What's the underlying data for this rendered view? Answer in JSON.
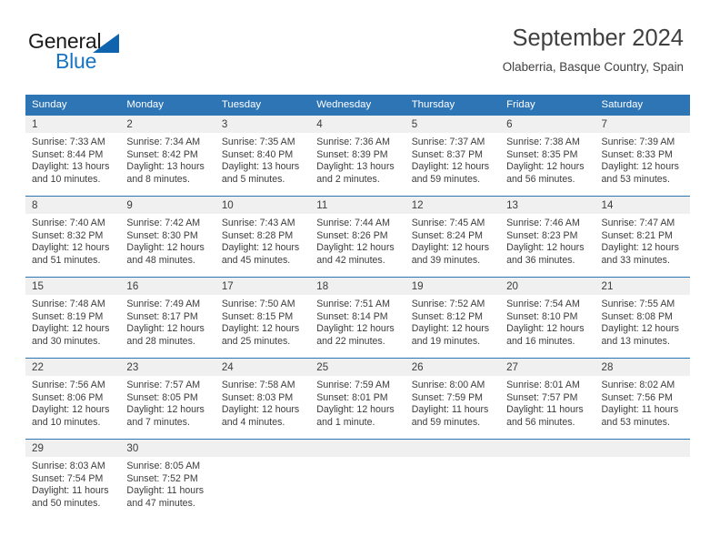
{
  "brand": {
    "name_part1": "General",
    "name_part2": "Blue",
    "logo_icon": "triangle-icon",
    "color_dark": "#1a1a1a",
    "color_blue": "#1773c4",
    "color_triangle": "#1064ad"
  },
  "header": {
    "title": "September 2024",
    "subtitle": "Olaberria, Basque Country, Spain"
  },
  "theme": {
    "header_row_bg": "#2e75b6",
    "daynum_bg": "#f0f0f0",
    "text": "#3c3c3c",
    "page_bg": "#ffffff"
  },
  "calendar": {
    "weekday_headers": [
      "Sunday",
      "Monday",
      "Tuesday",
      "Wednesday",
      "Thursday",
      "Friday",
      "Saturday"
    ],
    "weeks": [
      [
        {
          "day": "1",
          "sunrise": "Sunrise: 7:33 AM",
          "sunset": "Sunset: 8:44 PM",
          "daylight": "Daylight: 13 hours and 10 minutes."
        },
        {
          "day": "2",
          "sunrise": "Sunrise: 7:34 AM",
          "sunset": "Sunset: 8:42 PM",
          "daylight": "Daylight: 13 hours and 8 minutes."
        },
        {
          "day": "3",
          "sunrise": "Sunrise: 7:35 AM",
          "sunset": "Sunset: 8:40 PM",
          "daylight": "Daylight: 13 hours and 5 minutes."
        },
        {
          "day": "4",
          "sunrise": "Sunrise: 7:36 AM",
          "sunset": "Sunset: 8:39 PM",
          "daylight": "Daylight: 13 hours and 2 minutes."
        },
        {
          "day": "5",
          "sunrise": "Sunrise: 7:37 AM",
          "sunset": "Sunset: 8:37 PM",
          "daylight": "Daylight: 12 hours and 59 minutes."
        },
        {
          "day": "6",
          "sunrise": "Sunrise: 7:38 AM",
          "sunset": "Sunset: 8:35 PM",
          "daylight": "Daylight: 12 hours and 56 minutes."
        },
        {
          "day": "7",
          "sunrise": "Sunrise: 7:39 AM",
          "sunset": "Sunset: 8:33 PM",
          "daylight": "Daylight: 12 hours and 53 minutes."
        }
      ],
      [
        {
          "day": "8",
          "sunrise": "Sunrise: 7:40 AM",
          "sunset": "Sunset: 8:32 PM",
          "daylight": "Daylight: 12 hours and 51 minutes."
        },
        {
          "day": "9",
          "sunrise": "Sunrise: 7:42 AM",
          "sunset": "Sunset: 8:30 PM",
          "daylight": "Daylight: 12 hours and 48 minutes."
        },
        {
          "day": "10",
          "sunrise": "Sunrise: 7:43 AM",
          "sunset": "Sunset: 8:28 PM",
          "daylight": "Daylight: 12 hours and 45 minutes."
        },
        {
          "day": "11",
          "sunrise": "Sunrise: 7:44 AM",
          "sunset": "Sunset: 8:26 PM",
          "daylight": "Daylight: 12 hours and 42 minutes."
        },
        {
          "day": "12",
          "sunrise": "Sunrise: 7:45 AM",
          "sunset": "Sunset: 8:24 PM",
          "daylight": "Daylight: 12 hours and 39 minutes."
        },
        {
          "day": "13",
          "sunrise": "Sunrise: 7:46 AM",
          "sunset": "Sunset: 8:23 PM",
          "daylight": "Daylight: 12 hours and 36 minutes."
        },
        {
          "day": "14",
          "sunrise": "Sunrise: 7:47 AM",
          "sunset": "Sunset: 8:21 PM",
          "daylight": "Daylight: 12 hours and 33 minutes."
        }
      ],
      [
        {
          "day": "15",
          "sunrise": "Sunrise: 7:48 AM",
          "sunset": "Sunset: 8:19 PM",
          "daylight": "Daylight: 12 hours and 30 minutes."
        },
        {
          "day": "16",
          "sunrise": "Sunrise: 7:49 AM",
          "sunset": "Sunset: 8:17 PM",
          "daylight": "Daylight: 12 hours and 28 minutes."
        },
        {
          "day": "17",
          "sunrise": "Sunrise: 7:50 AM",
          "sunset": "Sunset: 8:15 PM",
          "daylight": "Daylight: 12 hours and 25 minutes."
        },
        {
          "day": "18",
          "sunrise": "Sunrise: 7:51 AM",
          "sunset": "Sunset: 8:14 PM",
          "daylight": "Daylight: 12 hours and 22 minutes."
        },
        {
          "day": "19",
          "sunrise": "Sunrise: 7:52 AM",
          "sunset": "Sunset: 8:12 PM",
          "daylight": "Daylight: 12 hours and 19 minutes."
        },
        {
          "day": "20",
          "sunrise": "Sunrise: 7:54 AM",
          "sunset": "Sunset: 8:10 PM",
          "daylight": "Daylight: 12 hours and 16 minutes."
        },
        {
          "day": "21",
          "sunrise": "Sunrise: 7:55 AM",
          "sunset": "Sunset: 8:08 PM",
          "daylight": "Daylight: 12 hours and 13 minutes."
        }
      ],
      [
        {
          "day": "22",
          "sunrise": "Sunrise: 7:56 AM",
          "sunset": "Sunset: 8:06 PM",
          "daylight": "Daylight: 12 hours and 10 minutes."
        },
        {
          "day": "23",
          "sunrise": "Sunrise: 7:57 AM",
          "sunset": "Sunset: 8:05 PM",
          "daylight": "Daylight: 12 hours and 7 minutes."
        },
        {
          "day": "24",
          "sunrise": "Sunrise: 7:58 AM",
          "sunset": "Sunset: 8:03 PM",
          "daylight": "Daylight: 12 hours and 4 minutes."
        },
        {
          "day": "25",
          "sunrise": "Sunrise: 7:59 AM",
          "sunset": "Sunset: 8:01 PM",
          "daylight": "Daylight: 12 hours and 1 minute."
        },
        {
          "day": "26",
          "sunrise": "Sunrise: 8:00 AM",
          "sunset": "Sunset: 7:59 PM",
          "daylight": "Daylight: 11 hours and 59 minutes."
        },
        {
          "day": "27",
          "sunrise": "Sunrise: 8:01 AM",
          "sunset": "Sunset: 7:57 PM",
          "daylight": "Daylight: 11 hours and 56 minutes."
        },
        {
          "day": "28",
          "sunrise": "Sunrise: 8:02 AM",
          "sunset": "Sunset: 7:56 PM",
          "daylight": "Daylight: 11 hours and 53 minutes."
        }
      ],
      [
        {
          "day": "29",
          "sunrise": "Sunrise: 8:03 AM",
          "sunset": "Sunset: 7:54 PM",
          "daylight": "Daylight: 11 hours and 50 minutes."
        },
        {
          "day": "30",
          "sunrise": "Sunrise: 8:05 AM",
          "sunset": "Sunset: 7:52 PM",
          "daylight": "Daylight: 11 hours and 47 minutes."
        },
        {
          "day": "",
          "sunrise": "",
          "sunset": "",
          "daylight": ""
        },
        {
          "day": "",
          "sunrise": "",
          "sunset": "",
          "daylight": ""
        },
        {
          "day": "",
          "sunrise": "",
          "sunset": "",
          "daylight": ""
        },
        {
          "day": "",
          "sunrise": "",
          "sunset": "",
          "daylight": ""
        },
        {
          "day": "",
          "sunrise": "",
          "sunset": "",
          "daylight": ""
        }
      ]
    ]
  }
}
